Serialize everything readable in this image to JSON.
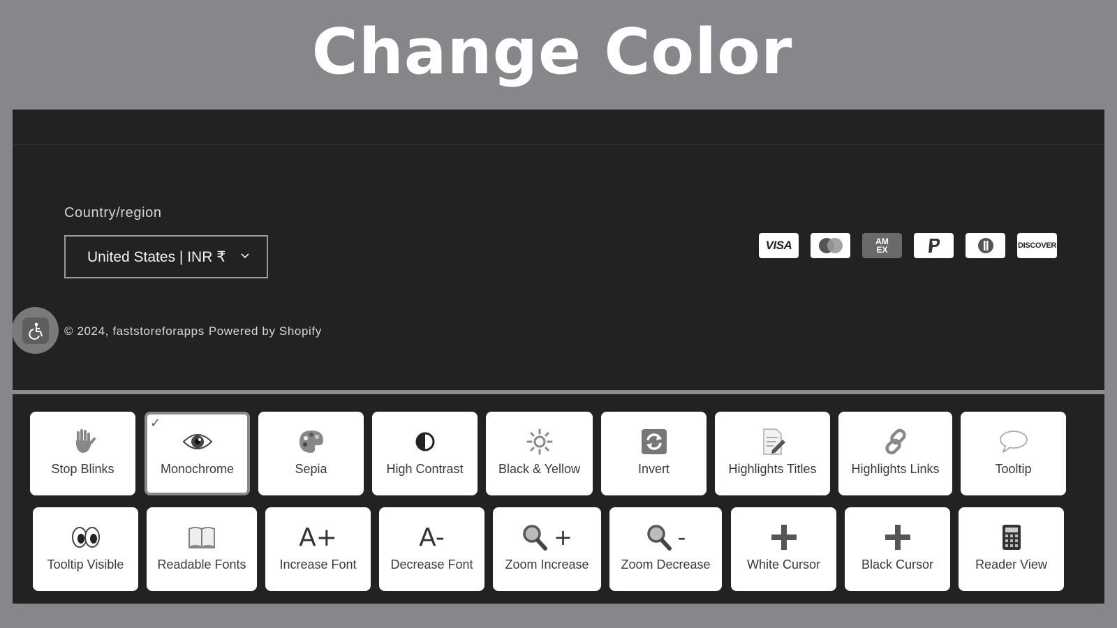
{
  "headline": "Change Color",
  "footer": {
    "country_label": "Country/region",
    "country_value": "United States | INR ₹",
    "copyright_year": "© 2024, faststoreforapps",
    "powered_by": "Powered by Shopify",
    "payment_methods": [
      "VISA",
      "Mastercard",
      "AM EX",
      "PayPal",
      "Diners",
      "DISCOVER"
    ]
  },
  "tools": {
    "row1": [
      {
        "label": "Stop Blinks",
        "icon": "hand-icon"
      },
      {
        "label": "Monochrome",
        "icon": "eye-icon",
        "active": true
      },
      {
        "label": "Sepia",
        "icon": "palette-icon"
      },
      {
        "label": "High Contrast",
        "icon": "contrast-icon"
      },
      {
        "label": "Black & Yellow",
        "icon": "sun-icon"
      },
      {
        "label": "Invert",
        "icon": "invert-icon"
      },
      {
        "label": "Highlights Titles",
        "icon": "document-pencil-icon"
      },
      {
        "label": "Highlights Links",
        "icon": "link-icon"
      },
      {
        "label": "Tooltip",
        "icon": "speech-bubble-icon"
      }
    ],
    "row2": [
      {
        "label": "Tooltip Visible",
        "icon": "eyes-icon"
      },
      {
        "label": "Readable Fonts",
        "icon": "book-icon"
      },
      {
        "label": "Increase Font",
        "icon": "font-increase-icon",
        "glyph": "A+"
      },
      {
        "label": "Decrease Font",
        "icon": "font-decrease-icon",
        "glyph": "A-"
      },
      {
        "label": "Zoom Increase",
        "icon": "zoom-in-icon",
        "glyph": "+"
      },
      {
        "label": "Zoom Decrease",
        "icon": "zoom-out-icon",
        "glyph": "-"
      },
      {
        "label": "White Cursor",
        "icon": "plus-cursor-icon"
      },
      {
        "label": "Black Cursor",
        "icon": "plus-cursor-icon"
      },
      {
        "label": "Reader View",
        "icon": "calculator-icon"
      }
    ]
  }
}
